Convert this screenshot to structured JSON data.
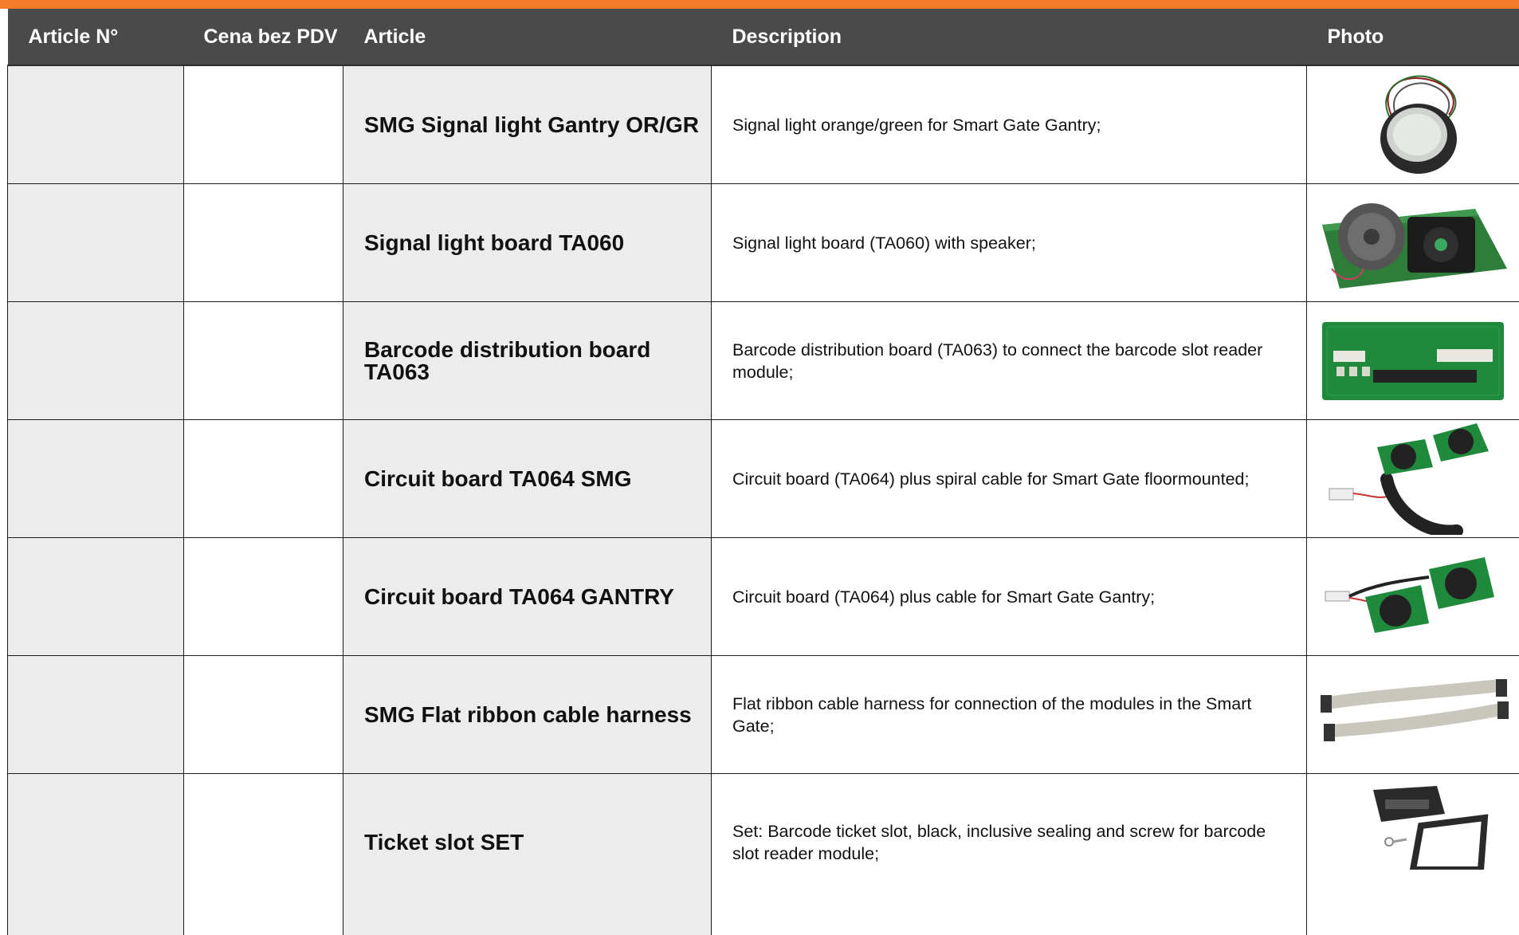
{
  "header": {
    "article_no": "Article N°",
    "price": "Cena bez PDV",
    "article": "Article",
    "description": "Description",
    "photo": "Photo"
  },
  "rows": [
    {
      "article": "SMG Signal light Gantry OR/GR",
      "description": "Signal light orange/green for Smart Gate Gantry;",
      "photo_icon": "signal-light-photo"
    },
    {
      "article": "Signal light board TA060",
      "description": "Signal light board (TA060) with speaker;",
      "photo_icon": "speaker-board-photo"
    },
    {
      "article": "Barcode distribution board TA063",
      "description": "Barcode distribution board (TA063) to connect the barcode slot reader module;",
      "photo_icon": "circuit-board-photo"
    },
    {
      "article": "Circuit board TA064 SMG",
      "description": "Circuit board (TA064) plus spiral cable for Smart Gate floormounted;",
      "photo_icon": "spiral-cable-board-photo"
    },
    {
      "article": "Circuit board TA064 GANTRY",
      "description": "Circuit board (TA064) plus cable for Smart Gate Gantry;",
      "photo_icon": "cable-board-photo"
    },
    {
      "article": "SMG Flat ribbon cable harness",
      "description": "Flat ribbon cable harness for connection of the modules in the Smart Gate;",
      "photo_icon": "ribbon-cable-photo"
    },
    {
      "article": "Ticket slot SET",
      "description": "Set: Barcode ticket slot, black, inclusive sealing and screw for barcode slot reader module;",
      "photo_icon": "ticket-slot-photo"
    }
  ],
  "colors": {
    "accent_bar": "#f47b2a",
    "header_bg": "#4a4a4a",
    "shaded_cell": "#ececec",
    "pcb_green": "#1f8a3c"
  }
}
